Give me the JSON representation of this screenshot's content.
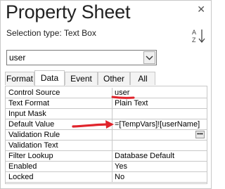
{
  "window": {
    "title": "Property Sheet"
  },
  "selection": {
    "label": "Selection type:  Text Box"
  },
  "combo": {
    "value": "user"
  },
  "tabs": [
    {
      "label": "Format"
    },
    {
      "label": "Data"
    },
    {
      "label": "Event"
    },
    {
      "label": "Other"
    },
    {
      "label": "All"
    }
  ],
  "active_tab": "Data",
  "properties": [
    {
      "name": "Control Source",
      "value": "user"
    },
    {
      "name": "Text Format",
      "value": "Plain Text"
    },
    {
      "name": "Input Mask",
      "value": ""
    },
    {
      "name": "Default Value",
      "value": "=[TempVars]![userName]"
    },
    {
      "name": "Validation Rule",
      "value": ""
    },
    {
      "name": "Validation Text",
      "value": ""
    },
    {
      "name": "Filter Lookup",
      "value": "Database Default"
    },
    {
      "name": "Enabled",
      "value": "Yes"
    },
    {
      "name": "Locked",
      "value": "No"
    }
  ],
  "icons": {
    "sort": "sort-az-icon",
    "dropdown": "chevron-down-icon",
    "build": "ellipsis-icon",
    "close": "close-icon"
  },
  "colors": {
    "annotation": "#e0232b",
    "border": "#c8c8c8"
  }
}
